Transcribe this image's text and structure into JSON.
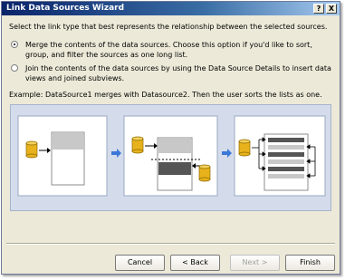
{
  "window": {
    "title": "Link Data Sources Wizard",
    "help_label": "?",
    "close_label": "X"
  },
  "instructions": "Select the link type that best represents the relationship between the selected sources.",
  "options": [
    {
      "label": "Merge the contents of the data sources. Choose this option if you'd like to sort, group, and filter the sources as one long list.",
      "selected": true
    },
    {
      "label": "Join the contents of the data sources by using the Data Source Details to insert data views and joined subviews.",
      "selected": false
    }
  ],
  "example_text": "Example: DataSource1 merges with Datasource2. Then the user sorts the lists as one.",
  "buttons": {
    "cancel": "Cancel",
    "back": "< Back",
    "next": "Next >",
    "finish": "Finish"
  },
  "colors": {
    "panel_bg": "#d4dcec",
    "db_gold": "#e8b21c",
    "arrow_blue": "#3c78d8"
  }
}
